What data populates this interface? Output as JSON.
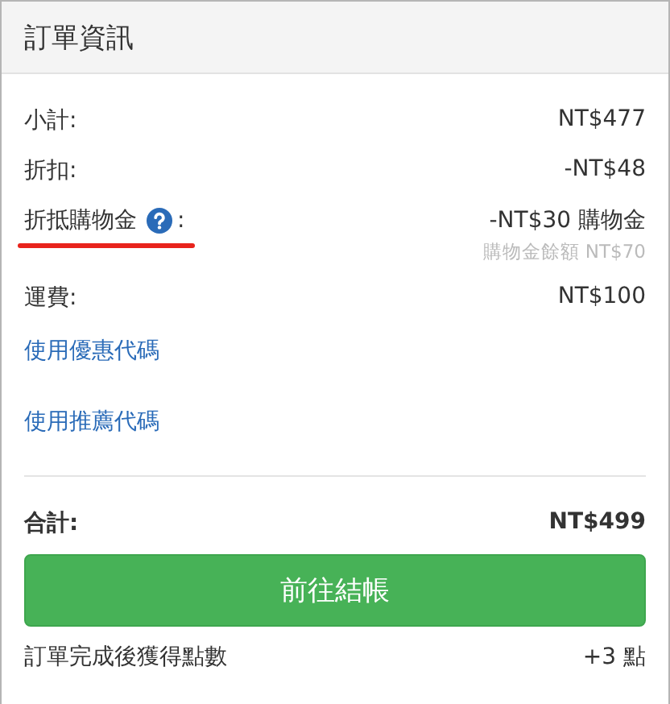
{
  "panel": {
    "title": "訂單資訊"
  },
  "rows": [
    {
      "kind": "line",
      "label": "小計:",
      "value": "NT$477"
    },
    {
      "kind": "line",
      "label": "折扣:",
      "value": "-NT$48"
    },
    {
      "kind": "credit",
      "label": "折抵購物金",
      "help": true,
      "label_suffix": ":",
      "value": "-NT$30 購物金",
      "note": "購物金餘額 NT$70",
      "highlighted": true
    },
    {
      "kind": "line",
      "label": "運費:",
      "value": "NT$100"
    },
    {
      "kind": "link",
      "label": "使用優惠代碼"
    },
    {
      "kind": "link",
      "label": "使用推薦代碼"
    }
  ],
  "total": {
    "label": "合計:",
    "value": "NT$499"
  },
  "checkout_button": "前往結帳",
  "points": {
    "label": "訂單完成後獲得點數",
    "value": "+3 點"
  }
}
